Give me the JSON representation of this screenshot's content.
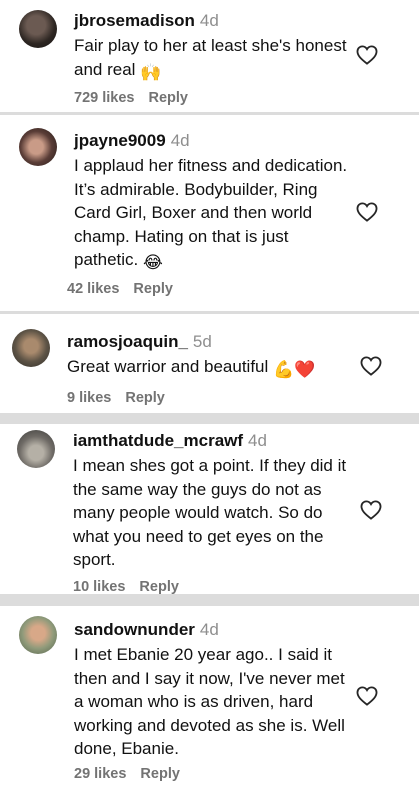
{
  "comments": [
    {
      "username": "jbrosemadison",
      "age": "4d",
      "text": "Fair play to her at least she's honest and real",
      "emoji": "🙌",
      "likes": "729 likes",
      "reply": "Reply"
    },
    {
      "username": "jpayne9009",
      "age": "4d",
      "text": "I applaud her fitness and dedication. It’s admirable. Bodybuilder, Ring Card Girl, Boxer and then world champ. Hating on that is just pathetic.",
      "emoji": "😂",
      "likes": "42 likes",
      "reply": "Reply"
    },
    {
      "username": "ramosjoaquin_",
      "age": "5d",
      "text": "Great warrior and beautiful",
      "emoji": "💪❤️",
      "likes": "9 likes",
      "reply": "Reply"
    },
    {
      "username": "iamthatdude_mcrawf",
      "age": "4d",
      "text": "I mean shes got a point. If they did it the same way the guys do not as many people would watch. So do what you need to get eyes on the sport.",
      "emoji": "",
      "likes": "10 likes",
      "reply": "Reply"
    },
    {
      "username": "sandownunder",
      "age": "4d",
      "text": "I met Ebanie 20 year ago.. I said it then and I say it now, I've never met a woman who is as driven, hard working and devoted as she is. Well done, Ebanie.",
      "emoji": "",
      "likes": "29 likes",
      "reply": "Reply"
    }
  ]
}
